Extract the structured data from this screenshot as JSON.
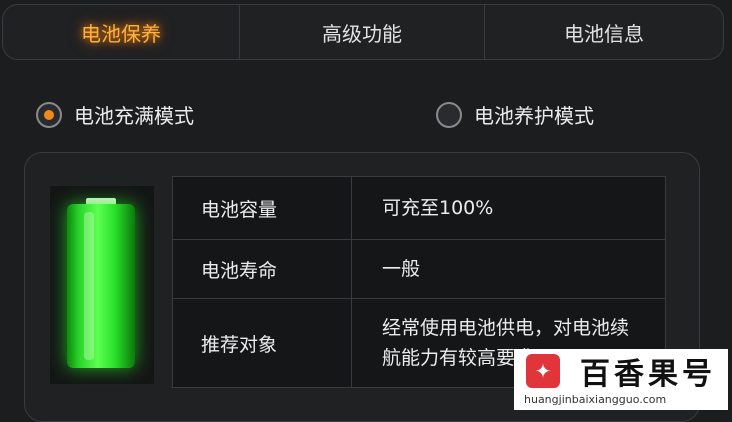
{
  "tabs": [
    {
      "label": "电池保养",
      "active": true
    },
    {
      "label": "高级功能",
      "active": false
    },
    {
      "label": "电池信息",
      "active": false
    }
  ],
  "modes": {
    "full_charge": {
      "label": "电池充满模式",
      "selected": true
    },
    "care": {
      "label": "电池养护模式",
      "selected": false
    }
  },
  "battery": {
    "icon": "battery-icon",
    "level_fraction": 1.0,
    "color": "#33e033"
  },
  "info": {
    "capacity": {
      "key": "电池容量",
      "value": "可充至100%"
    },
    "life": {
      "key": "电池寿命",
      "value": "一般"
    },
    "recommended": {
      "key": "推荐对象",
      "value_line1": "经常使用电池供电，对电池续",
      "value_line2": "航能力有较高要求"
    }
  },
  "watermark": {
    "brand": "百香果号",
    "url": "huangjinbaixiangguo.com",
    "logo_icon": "star-icon"
  },
  "colors": {
    "accent": "#f08a1c",
    "active_tab_glow": "#ffb23a",
    "background": "#1c1d1f"
  }
}
